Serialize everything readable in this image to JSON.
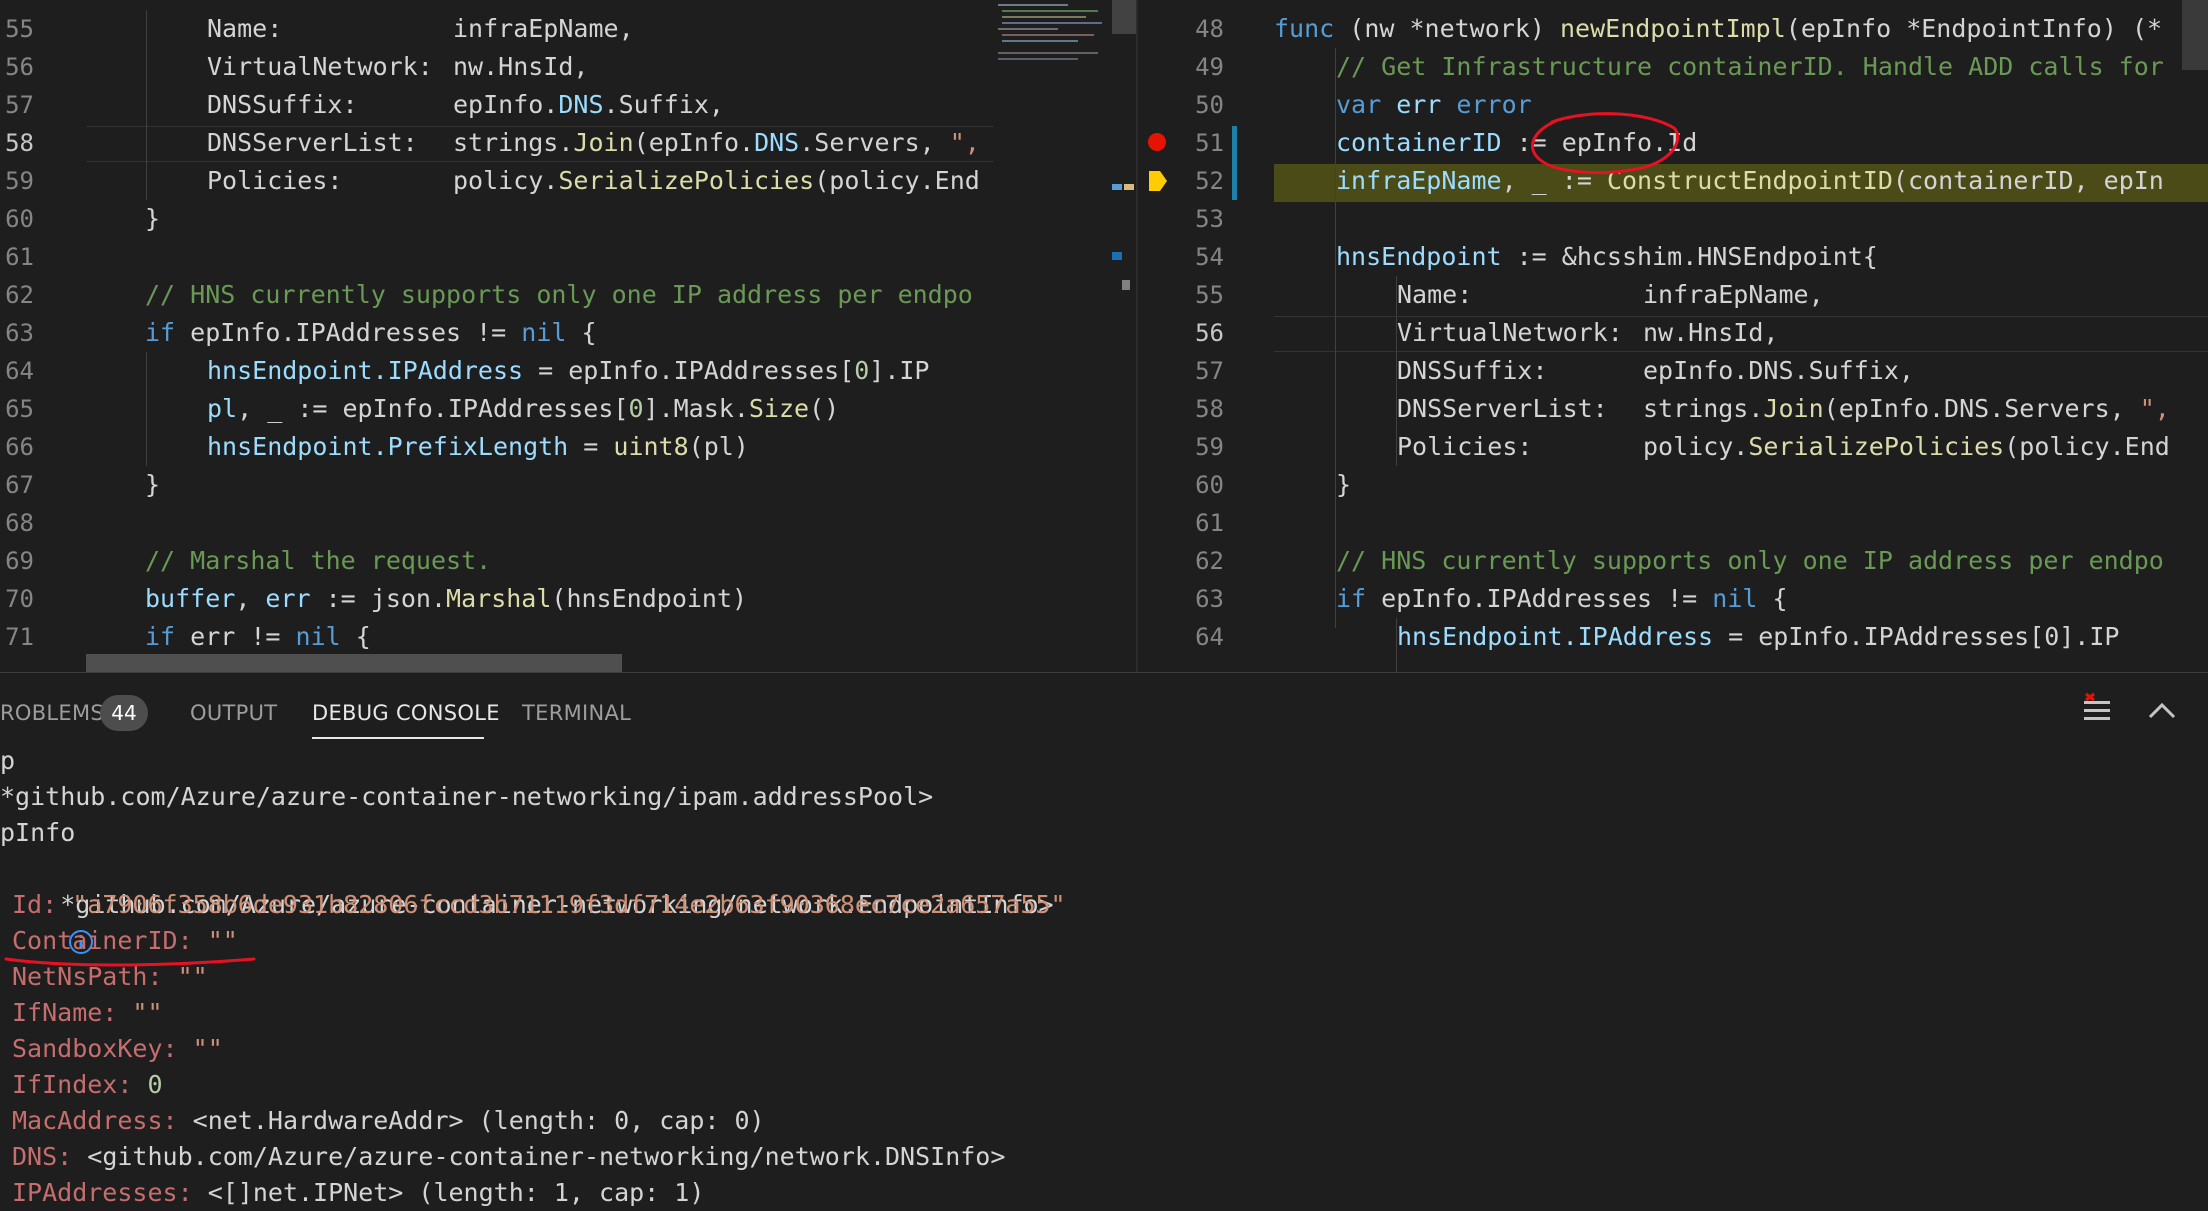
{
  "colors": {
    "editor_bg": "#1e1e1e",
    "keyword": "#569cd6",
    "function": "#dcdcaa",
    "comment": "#6a9955",
    "variable": "#9cdcfe",
    "string": "#ce9178",
    "debug_highlight": "#4b4b18",
    "breakpoint": "#e51400",
    "annotation": "#e81123"
  },
  "left_editor": {
    "line_numbers": [
      "55",
      "56",
      "57",
      "58",
      "59",
      "60",
      "61",
      "62",
      "63",
      "64",
      "65",
      "66",
      "67",
      "68",
      "69",
      "70",
      "71"
    ],
    "active_line": "58",
    "code": {
      "l55a": "Name:",
      "l55b": "infraEpName,",
      "l56a": "VirtualNetwork:",
      "l56b": "nw.HnsId,",
      "l57a": "DNSSuffix:",
      "l57b": "epInfo.",
      "l57c": "DNS",
      "l57d": ".Suffix,",
      "l58a": "DNSServerList:",
      "l58b": "strings.",
      "l58c": "Join",
      "l58d": "(epInfo.",
      "l58e": "DNS",
      "l58f": ".Servers, ",
      "l58g": "\",",
      "l59a": "Policies:",
      "l59b": "policy.",
      "l59c": "SerializePolicies",
      "l59d": "(policy.End",
      "l60": "}",
      "l62": "// HNS currently supports only one IP address per endpo",
      "l63a": "if",
      "l63b": " epInfo.IPAddresses != ",
      "l63c": "nil",
      "l63d": " {",
      "l64a": "hnsEndpoint.IPAddress",
      "l64b": " = epInfo.IPAddresses[",
      "l64c": "0",
      "l64d": "].IP",
      "l65a": "pl",
      "l65b": ", _ := epInfo.IPAddresses[",
      "l65c": "0",
      "l65d": "].Mask.",
      "l65e": "Size",
      "l65f": "()",
      "l66a": "hnsEndpoint.PrefixLength",
      "l66b": " = ",
      "l66c": "uint8",
      "l66d": "(pl)",
      "l67": "}",
      "l69": "// Marshal the request.",
      "l70a": "buffer",
      "l70b": ", ",
      "l70c": "err",
      "l70d": " := json.",
      "l70e": "Marshal",
      "l70f": "(hnsEndpoint)",
      "l71a": "if",
      "l71b": " err != ",
      "l71c": "nil",
      "l71d": " {"
    }
  },
  "right_editor": {
    "line_numbers": [
      "48",
      "49",
      "50",
      "51",
      "52",
      "53",
      "54",
      "55",
      "56",
      "57",
      "58",
      "59",
      "60",
      "61",
      "62",
      "63",
      "64"
    ],
    "active_line": "56",
    "code": {
      "r48a": "func",
      "r48b": " (nw *network) ",
      "r48c": "newEndpointImpl",
      "r48d": "(epInfo *EndpointInfo) (*",
      "r49": "// Get Infrastructure containerID. Handle ADD calls for",
      "r50a": "var",
      "r50b": " err",
      "r50c": " error",
      "r51a": "containerID",
      "r51b": " := epInfo.Id",
      "r52a": "infraEpName",
      "r52b": ", _ := ",
      "r52c": "ConstructEndpointID",
      "r52d": "(containerID, epIn",
      "r54a": "hnsEndpoint",
      "r54b": " := &hcsshim.HNSEndpoint{",
      "r55a": "Name:",
      "r55b": "infraEpName,",
      "r56a": "VirtualNetwork:",
      "r56b": "nw.HnsId,",
      "r57a": "DNSSuffix:",
      "r57b": "epInfo.DNS.Suffix,",
      "r58a": "DNSServerList:",
      "r58b": "strings.",
      "r58c": "Join",
      "r58d": "(epInfo.DNS.Servers, ",
      "r58e": "\",",
      "r59a": "Policies:",
      "r59b": "policy.",
      "r59c": "SerializePolicies",
      "r59d": "(policy.End",
      "r60": "}",
      "r62": "// HNS currently supports only one IP address per endpo",
      "r63a": "if",
      "r63b": " epInfo.IPAddresses != ",
      "r63c": "nil",
      "r63d": " {",
      "r64a": "hnsEndpoint.IPAddress",
      "r64b": " = epInfo.IPAddresses[0].IP"
    }
  },
  "panel": {
    "tabs": {
      "problems": "ROBLEMS",
      "problems_count": "44",
      "output": "OUTPUT",
      "debug_console": "DEBUG CONSOLE",
      "terminal": "TERMINAL"
    },
    "console": {
      "c1": "p",
      "c2": "*github.com/Azure/azure-container-networking/ipam.addressPool>",
      "c3": "pInfo",
      "c4": "*github.com/Azure/azure-container-networking/network.EndpointInfo>",
      "id_key": "Id:",
      "id_val": "\"a7906f358b6de931b82806fccd3b71119f3df714e2b63f90368ec7ce2a657a55\"",
      "cid_key": "ContainerID:",
      "cid_val": "\"\"",
      "netns_key": "NetNsPath:",
      "netns_val": "\"\"",
      "ifname_key": "IfName:",
      "ifname_val": "\"\"",
      "sandbox_key": "SandboxKey:",
      "sandbox_val": "\"\"",
      "ifindex_key": "IfIndex:",
      "ifindex_val": "0",
      "mac_key": "MacAddress:",
      "mac_val": "<net.HardwareAddr> (length: 0, cap: 0)",
      "dns_key": "DNS:",
      "dns_val": "<github.com/Azure/azure-container-networking/network.DNSInfo>",
      "ip_key": "IPAddresses:",
      "ip_val": "<[]net.IPNet> (length: 1, cap: 1)"
    }
  }
}
